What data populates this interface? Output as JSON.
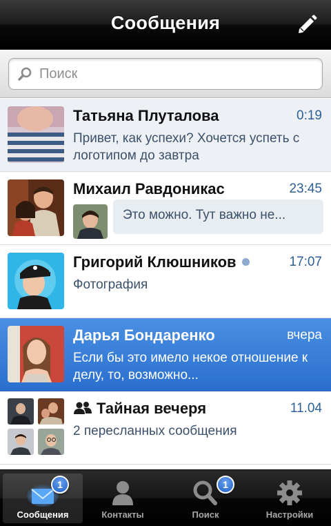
{
  "header": {
    "title": "Сообщения",
    "compose_icon": "pencil-icon"
  },
  "search": {
    "placeholder": "Поиск",
    "icon": "search-icon"
  },
  "conversations": [
    {
      "name": "Татьяна Плуталова",
      "time": "0:19",
      "snippet": "Привет, как успехи? Хочется успеть с логотипом до завтра",
      "unread": true
    },
    {
      "name": "Михаил Равдоникас",
      "time": "23:45",
      "reply": "Это можно. Тут важно не..."
    },
    {
      "name": "Григорий Клюшников",
      "time": "17:07",
      "snippet": "Фотография",
      "online": true
    },
    {
      "name": "Дарья Бондаренко",
      "time": "вчера",
      "snippet": "Если бы это имело некое отношение к делу, то, возможно...",
      "selected": true
    },
    {
      "name": "Тайная вечеря",
      "time": "11.04",
      "snippet": "2 пересланных сообщения",
      "group": true
    }
  ],
  "tabbar": {
    "tabs": [
      {
        "label": "Сообщения",
        "icon": "envelope-icon",
        "badge": "1",
        "active": true
      },
      {
        "label": "Контакты",
        "icon": "person-icon"
      },
      {
        "label": "Поиск",
        "icon": "magnifier-icon",
        "badge": "1"
      },
      {
        "label": "Настройки",
        "icon": "gear-icon"
      }
    ]
  },
  "colors": {
    "accent": "#2a6fcf",
    "time": "#2c5f96",
    "unread_bg": "#edf1f5"
  }
}
